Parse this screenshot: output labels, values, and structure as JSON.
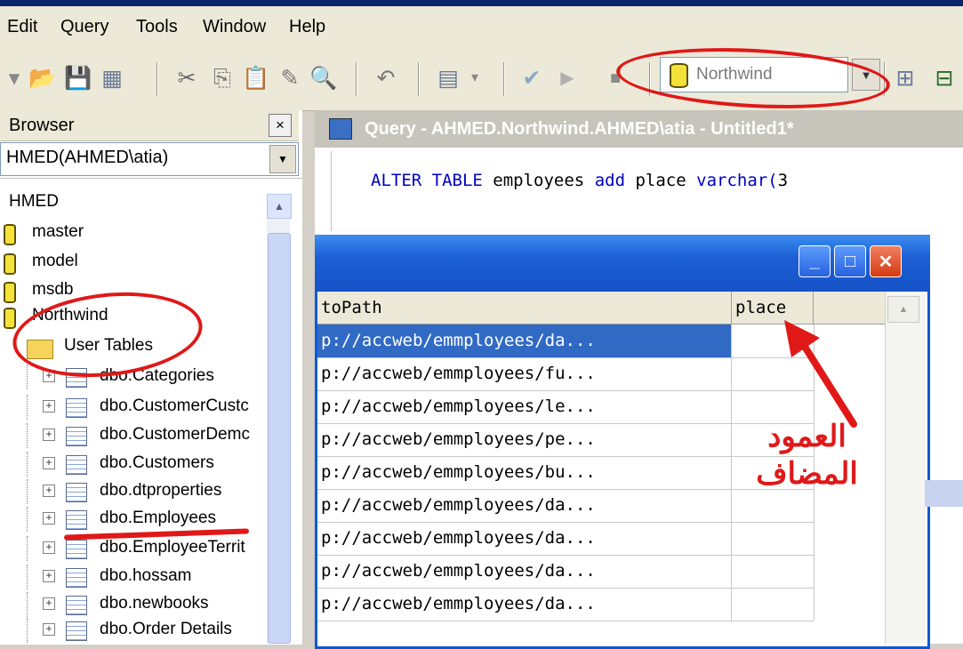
{
  "menu": [
    "Edit",
    "Query",
    "Tools",
    "Window",
    "Help"
  ],
  "toolbar": {
    "database": "Northwind"
  },
  "browser": {
    "title": "Browser",
    "close": "×",
    "server_value": "HMED(AHMED\\atia)",
    "root": "HMED",
    "databases": [
      "master",
      "model",
      "msdb",
      "Northwind"
    ],
    "folder": "User Tables",
    "tables": [
      "dbo.Categories",
      "dbo.CustomerCustc",
      "dbo.CustomerDemc",
      "dbo.Customers",
      "dbo.dtproperties",
      "dbo.Employees",
      "dbo.EmployeeTerrit",
      "dbo.hossam",
      "dbo.newbooks",
      "dbo.Order Details"
    ]
  },
  "query_window": {
    "title": "Query - AHMED.Northwind.AHMED\\atia - Untitled1*",
    "sql": {
      "kw1": "ALTER TABLE",
      "t1": "employees",
      "kw2": "add",
      "t2": "place",
      "kw3": "varchar(",
      "t3": "3"
    }
  },
  "results": {
    "columns": [
      "toPath",
      "place"
    ],
    "rows": [
      {
        "toPath": "p://accweb/emmployees/da...",
        "place": ""
      },
      {
        "toPath": "p://accweb/emmployees/fu...",
        "place": ""
      },
      {
        "toPath": "p://accweb/emmployees/le...",
        "place": ""
      },
      {
        "toPath": "p://accweb/emmployees/pe...",
        "place": ""
      },
      {
        "toPath": "p://accweb/emmployees/bu...",
        "place": ""
      },
      {
        "toPath": "p://accweb/emmployees/da...",
        "place": ""
      },
      {
        "toPath": "p://accweb/emmployees/da...",
        "place": ""
      },
      {
        "toPath": "p://accweb/emmployees/da...",
        "place": ""
      },
      {
        "toPath": "p://accweb/emmployees/da...",
        "place": ""
      }
    ],
    "selected_row": 0
  },
  "annotation": {
    "line1": "العمود",
    "line2": "المضاف",
    "color": "#e01818"
  }
}
